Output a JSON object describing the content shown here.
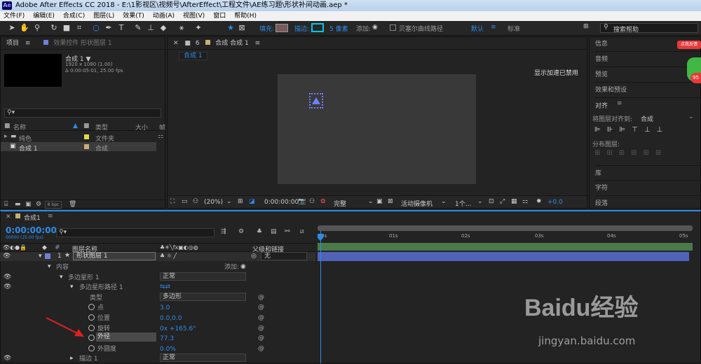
{
  "window": {
    "title": "Adobe After Effects CC 2018 - E:\\1影视区\\视频号\\AfterEffect\\工程文件\\AE练习题\\形状补间动画.aep *",
    "logo": "Ae"
  },
  "menu": [
    "文件(F)",
    "编辑(E)",
    "合成(C)",
    "图层(L)",
    "效果(T)",
    "动画(A)",
    "视图(V)",
    "窗口",
    "帮助(H)"
  ],
  "toolbar": {
    "fill_label": "填充:",
    "stroke_label": "描边:",
    "stroke_px": "5 像素",
    "add_label": "添加:",
    "bezier_label": "贝塞尔曲线路径",
    "default_label": "默认",
    "standard_label": "标准",
    "search_placeholder": "搜索帮助"
  },
  "project": {
    "tab": "项目",
    "effects_tab": "效果控件 形状图层 1",
    "comp_name": "合成 1 ▼",
    "comp_info1": "1920 x 1080 (1.00)",
    "comp_info2": "Δ 0:00:05:01, 25.00 fps",
    "col_name": "名称",
    "col_type": "类型",
    "col_size": "大小",
    "col_frame": "帧",
    "items": [
      {
        "name": "纯色",
        "type": "文件夹",
        "color": "#e0d846"
      },
      {
        "name": "合成 1",
        "type": "合成",
        "color": "#c8b073"
      }
    ],
    "bpc": "8 bpc"
  },
  "comp_panel": {
    "tab": "合成 合成 1",
    "sub_tab": "合成 1",
    "notice": "显示加速已禁用",
    "zoom": "(20%)",
    "time": "0:00:00:00",
    "quality": "完整",
    "camera": "活动摄像机",
    "views": "1个...",
    "offset": "+0.0"
  },
  "right_panel": {
    "items": [
      "信息",
      "音频",
      "预览",
      "效果和预设"
    ],
    "align_title": "对齐",
    "align_to_label": "将图层对齐到:",
    "align_to_value": "合成",
    "distribute_label": "分布图层:",
    "items2": [
      "库",
      "字符",
      "段落"
    ],
    "badge": "点我反馈"
  },
  "timeline": {
    "tab": "合成1",
    "timecode": "0:00:00:00",
    "timecode_sub": "00000 (25.00 fps)",
    "col_layer_name": "图层名称",
    "col_parent": "父级和链接",
    "ticks": [
      "0s",
      "01s",
      "02s",
      "03s",
      "04s",
      "05s"
    ],
    "layer": {
      "num": "1",
      "name": "形状图层 1",
      "parent": "无"
    },
    "rows": [
      {
        "indent": 68,
        "label": "内容",
        "extra": "添加:"
      },
      {
        "indent": 85,
        "label": "多边星形 1",
        "mode": "正常"
      },
      {
        "indent": 100,
        "label": "多边星形路径 1"
      },
      {
        "indent": 118,
        "label": "类型",
        "mode": "多边形"
      },
      {
        "indent": 125,
        "label": "点",
        "value": "3.0"
      },
      {
        "indent": 125,
        "label": "位置",
        "value": "0.0,0.0"
      },
      {
        "indent": 125,
        "label": "旋转",
        "value": "0x +165.6°"
      },
      {
        "indent": 125,
        "label": "外径",
        "value": "77.3"
      },
      {
        "indent": 125,
        "label": "外圆度",
        "value": "0.0%"
      },
      {
        "indent": 100,
        "label": "描边 1",
        "mode": "正常"
      }
    ]
  },
  "watermark": {
    "brand": "Baidu经验",
    "url": "jingyan.baidu.com"
  }
}
